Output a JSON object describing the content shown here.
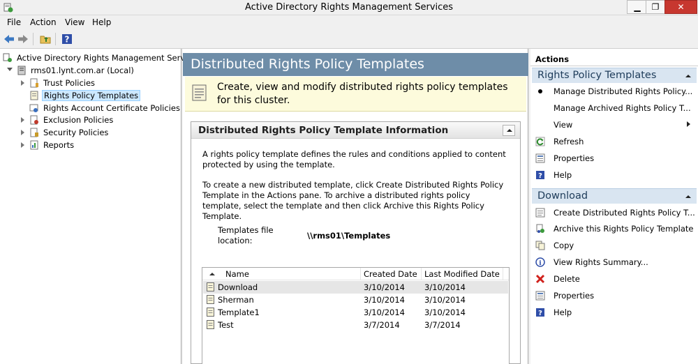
{
  "window": {
    "title": "Active Directory Rights Management Services",
    "minimize_glyph": "▁",
    "maximize_glyph": "❐",
    "close_glyph": "✕"
  },
  "menu": [
    "File",
    "Action",
    "View",
    "Help"
  ],
  "tree": {
    "root": "Active Directory Rights Management Services",
    "server": "rms01.lynt.com.ar (Local)",
    "items": [
      {
        "label": "Trust Policies",
        "icon": "trust-policies-icon",
        "expandable": true,
        "selected": false
      },
      {
        "label": "Rights Policy Templates",
        "icon": "templates-icon",
        "expandable": false,
        "selected": true
      },
      {
        "label": "Rights Account Certificate Policies",
        "icon": "certificate-icon",
        "expandable": false,
        "selected": false
      },
      {
        "label": "Exclusion Policies",
        "icon": "exclusion-icon",
        "expandable": true,
        "selected": false
      },
      {
        "label": "Security Policies",
        "icon": "security-icon",
        "expandable": true,
        "selected": false
      },
      {
        "label": "Reports",
        "icon": "reports-icon",
        "expandable": true,
        "selected": false
      }
    ]
  },
  "center": {
    "header": "Distributed Rights Policy Templates",
    "banner": "Create, view and modify distributed rights policy templates for this cluster.",
    "panel": {
      "title": "Distributed Rights Policy Template Information",
      "para1": "A rights policy template defines the rules and conditions applied to content protected by using the template.",
      "para2": "To create a new distributed template, click Create Distributed Rights Policy Template in the Actions pane. To archive a distributed rights policy template, select the template and then click Archive this Rights Policy Template.",
      "location_label": "Templates file location:",
      "location_value": "\\\\rms01\\Templates"
    },
    "list": {
      "columns": [
        "Name",
        "Created Date",
        "Last Modified Date"
      ],
      "rows": [
        {
          "name": "Download",
          "created": "3/10/2014",
          "modified": "3/10/2014",
          "selected": true
        },
        {
          "name": "Sherman",
          "created": "3/10/2014",
          "modified": "3/10/2014",
          "selected": false
        },
        {
          "name": "Template1",
          "created": "3/10/2014",
          "modified": "3/10/2014",
          "selected": false
        },
        {
          "name": "Test",
          "created": "3/7/2014",
          "modified": "3/7/2014",
          "selected": false
        }
      ]
    }
  },
  "actions": {
    "title": "Actions",
    "sections": [
      {
        "label": "Rights Policy Templates",
        "items": [
          {
            "label": "Manage Distributed Rights Policy...",
            "icon": "bullet-icon"
          },
          {
            "label": "Manage Archived Rights Policy T...",
            "icon": "none"
          },
          {
            "label": "View",
            "icon": "none",
            "submenu": true
          },
          {
            "label": "Refresh",
            "icon": "refresh-icon"
          },
          {
            "label": "Properties",
            "icon": "properties-icon"
          },
          {
            "label": "Help",
            "icon": "help-icon"
          }
        ]
      },
      {
        "label": "Download",
        "items": [
          {
            "label": "Create Distributed Rights Policy T...",
            "icon": "create-template-icon"
          },
          {
            "label": "Archive this Rights Policy Template",
            "icon": "archive-icon"
          },
          {
            "label": "Copy",
            "icon": "copy-icon"
          },
          {
            "label": "View Rights Summary...",
            "icon": "info-icon"
          },
          {
            "label": "Delete",
            "icon": "delete-icon"
          },
          {
            "label": "Properties",
            "icon": "properties-icon"
          },
          {
            "label": "Help",
            "icon": "help-icon"
          }
        ]
      }
    ]
  },
  "colors": {
    "header_bg": "#6e8da8",
    "banner_bg": "#fdfbdc",
    "section_bg": "#d9e5f1",
    "selection": "#cce8ff",
    "close_button": "#c7372f"
  }
}
